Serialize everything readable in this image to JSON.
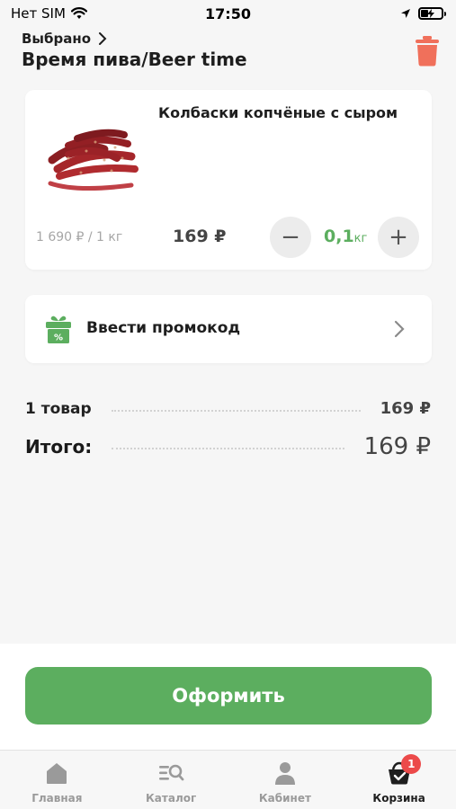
{
  "status_bar": {
    "carrier": "Нет SIM",
    "time": "17:50"
  },
  "header": {
    "selected_label": "Выбрано",
    "store_name": "Время пива/Beer time"
  },
  "cart_item": {
    "name": "Колбаски копчёные с сыром",
    "unit_price": "1 690 ₽ / 1 кг",
    "price": "169 ₽",
    "quantity": "0,1",
    "quantity_unit": "кг",
    "minus": "−",
    "plus": "+"
  },
  "promo": {
    "label": "Ввести промокод"
  },
  "summary": {
    "items_label": "1 товар",
    "items_value": "169 ₽",
    "total_label": "Итого:",
    "total_value": "169 ₽"
  },
  "checkout": {
    "button_label": "Оформить"
  },
  "tabbar": {
    "tabs": [
      {
        "label": "Главная",
        "icon": "home-icon"
      },
      {
        "label": "Каталог",
        "icon": "catalog-search-icon"
      },
      {
        "label": "Кабинет",
        "icon": "user-icon"
      },
      {
        "label": "Корзина",
        "icon": "basket-icon",
        "badge": "1",
        "active": true
      }
    ]
  },
  "colors": {
    "accent_green": "#5cae5f",
    "trash_red": "#f0705b",
    "badge_red": "#ec4a4a"
  }
}
